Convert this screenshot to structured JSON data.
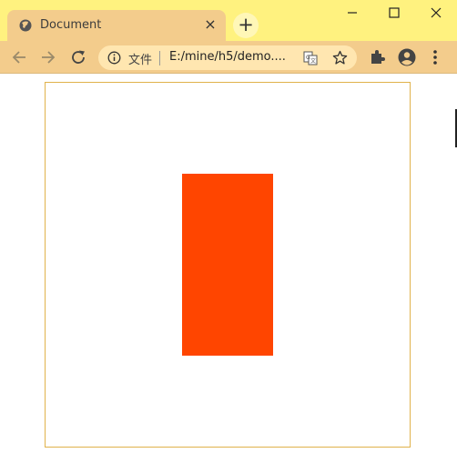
{
  "browser": {
    "tab_title": "Document",
    "tab_close_glyph": "×",
    "new_tab_glyph": "+",
    "address_site_label": "文件",
    "address_url": "E:/mine/h5/demo....",
    "icons": [
      "globe-icon",
      "close-icon",
      "plus-icon",
      "minimize-icon",
      "maximize-icon",
      "window-close-icon",
      "back-arrow-icon",
      "forward-arrow-icon",
      "reload-icon",
      "info-icon",
      "translate-icon",
      "star-icon",
      "extensions-icon",
      "profile-icon",
      "menu-icon"
    ]
  },
  "page": {
    "block_color": "#ff4500",
    "container_border_color": "#e0b24b"
  },
  "colors": {
    "titlebar": "#fff27f",
    "tab_and_toolbar": "#f3cc8c",
    "omnibox": "#ffe6b0"
  }
}
